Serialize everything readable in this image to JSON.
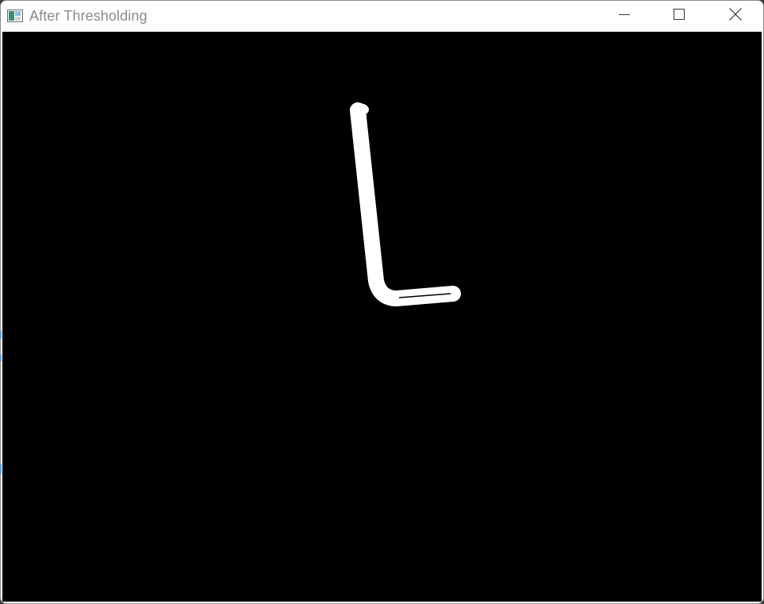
{
  "window": {
    "title": "After Thresholding",
    "icon": "image-window-icon",
    "buttons": {
      "minimize": "minimize-icon",
      "maximize": "maximize-icon",
      "close": "close-icon"
    }
  },
  "canvas": {
    "background": "#000000",
    "foreground": "#ffffff",
    "content": "thresholded-letter-L"
  },
  "colors": {
    "titlebar_bg": "#ffffff",
    "title_text": "#8a8a8a",
    "frame_border": "#8a8a8a"
  }
}
